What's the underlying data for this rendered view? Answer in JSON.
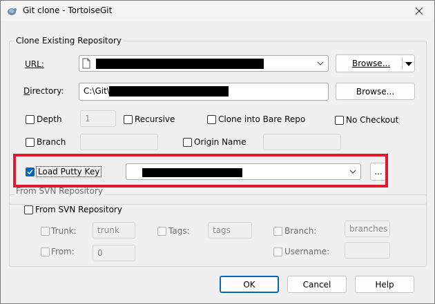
{
  "window": {
    "title": "Git clone - TortoiseGit"
  },
  "clone_group": {
    "label": "Clone Existing Repository",
    "url_label": "URL:",
    "url_value": "",
    "url_browse": "Browse...",
    "directory_label": "Directory:",
    "directory_value": "C:\\Git\\",
    "directory_browse": "Browse...",
    "depth_label": "Depth",
    "depth_value": "1",
    "recursive_label": "Recursive",
    "bare_label": "Clone into Bare Repo",
    "nocheckout_label": "No Checkout",
    "branch_label": "Branch",
    "branch_value": "",
    "origin_label": "Origin Name",
    "origin_value": "",
    "putty_label": "Load Putty Key",
    "putty_value": "",
    "putty_browse": "..."
  },
  "svn_group": {
    "label": "From SVN Repository",
    "from_svn_label": "From SVN Repository",
    "trunk_label": "Trunk:",
    "trunk_value": "trunk",
    "tags_label": "Tags:",
    "tags_value": "tags",
    "branch_label": "Branch:",
    "branch_value": "branches",
    "from_label": "From:",
    "from_value": "0",
    "username_label": "Username:",
    "username_value": ""
  },
  "buttons": {
    "ok": "OK",
    "cancel": "Cancel",
    "help": "Help"
  },
  "colors": {
    "accent": "#0067c0",
    "highlight": "#e1192a"
  }
}
